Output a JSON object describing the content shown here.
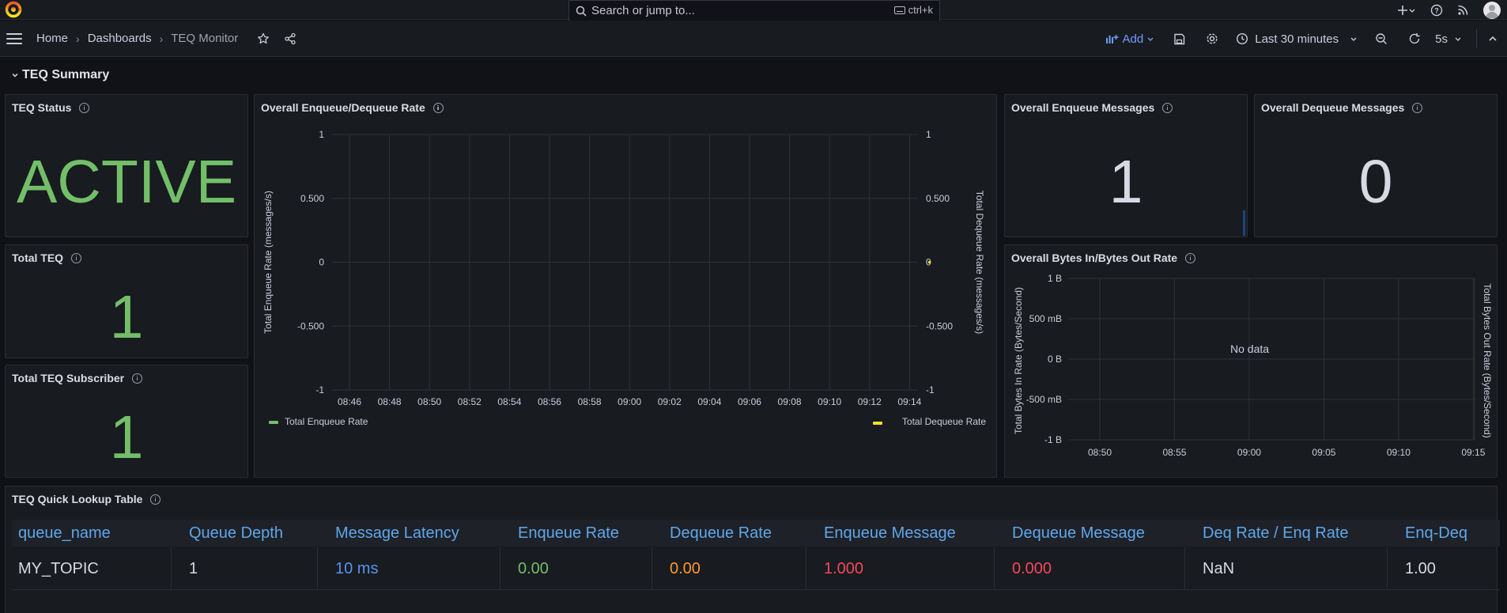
{
  "topbar": {
    "search_placeholder": "Search or jump to...",
    "search_shortcut": "ctrl+k"
  },
  "breadcrumb": {
    "home": "Home",
    "dashboards": "Dashboards",
    "current": "TEQ Monitor"
  },
  "toolbar": {
    "add_label": "Add",
    "time_range": "Last 30 minutes",
    "refresh_interval": "5s"
  },
  "row": {
    "title": "TEQ Summary"
  },
  "panels": {
    "teq_status": {
      "title": "TEQ Status",
      "value": "ACTIVE",
      "color": "#73bf69"
    },
    "total_teq": {
      "title": "Total TEQ",
      "value": "1",
      "color": "#73bf69"
    },
    "total_subscriber": {
      "title": "Total TEQ Subscriber",
      "value": "1",
      "color": "#73bf69"
    },
    "enqueue_messages": {
      "title": "Overall Enqueue Messages",
      "value": "1",
      "color": "#d8d9e3"
    },
    "dequeue_messages": {
      "title": "Overall Dequeue Messages",
      "value": "0",
      "color": "#d8d9e3"
    },
    "rate_chart": {
      "title": "Overall Enqueue/Dequeue Rate"
    },
    "bytes_chart": {
      "title": "Overall Bytes In/Bytes Out Rate",
      "no_data": "No data"
    }
  },
  "chart_data": [
    {
      "type": "line",
      "title": "Overall Enqueue/Dequeue Rate",
      "x": [
        "08:46",
        "08:48",
        "08:50",
        "08:52",
        "08:54",
        "08:56",
        "08:58",
        "09:00",
        "09:02",
        "09:04",
        "09:06",
        "09:08",
        "09:10",
        "09:12",
        "09:14"
      ],
      "ylabel": "Total Enqueue Rate (messages/s)",
      "y2label": "Total Dequeue Rate (messages/s)",
      "ylim": [
        -1,
        1
      ],
      "y_ticks": [
        "1",
        "0.500",
        "0",
        "-0.500",
        "-1"
      ],
      "series": [
        {
          "name": "Total Enqueue Rate",
          "color": "#73bf69",
          "points": []
        },
        {
          "name": "Total Dequeue Rate",
          "color": "#fade2a",
          "points": [
            {
              "x": "09:15",
              "y": 0
            }
          ]
        }
      ],
      "grid": true,
      "legend": "bottom"
    },
    {
      "type": "line",
      "title": "Overall Bytes In/Bytes Out Rate",
      "x": [
        "08:50",
        "08:55",
        "09:00",
        "09:05",
        "09:10",
        "09:15"
      ],
      "ylabel": "Total Bytes In Rate (Bytes/Second)",
      "y2label": "Total Bytes Out Rate (Bytes/Second)",
      "y_ticks": [
        "1 B",
        "500 mB",
        "0 B",
        "-500 mB",
        "-1 B"
      ],
      "ylim": [
        -1,
        1
      ],
      "series": [],
      "grid": true
    }
  ],
  "table": {
    "title": "TEQ Quick Lookup Table",
    "columns": [
      "queue_name",
      "Queue Depth",
      "Message Latency",
      "Enqueue Rate",
      "Dequeue Rate",
      "Enqueue Message",
      "Dequeue Message",
      "Deq Rate / Enq Rate",
      "Enq-Deq"
    ],
    "rows": [
      [
        "MY_TOPIC",
        "1",
        "10 ms",
        "0.00",
        "0.00",
        "1.000",
        "0.000",
        "NaN",
        "1.00"
      ]
    ],
    "cell_colors": [
      "#d8d9e3",
      "#d8d9e3",
      "#5794f2",
      "#73bf69",
      "#ff9830",
      "#f2495c",
      "#f2495c",
      "#d8d9e3",
      "#d8d9e3"
    ]
  }
}
